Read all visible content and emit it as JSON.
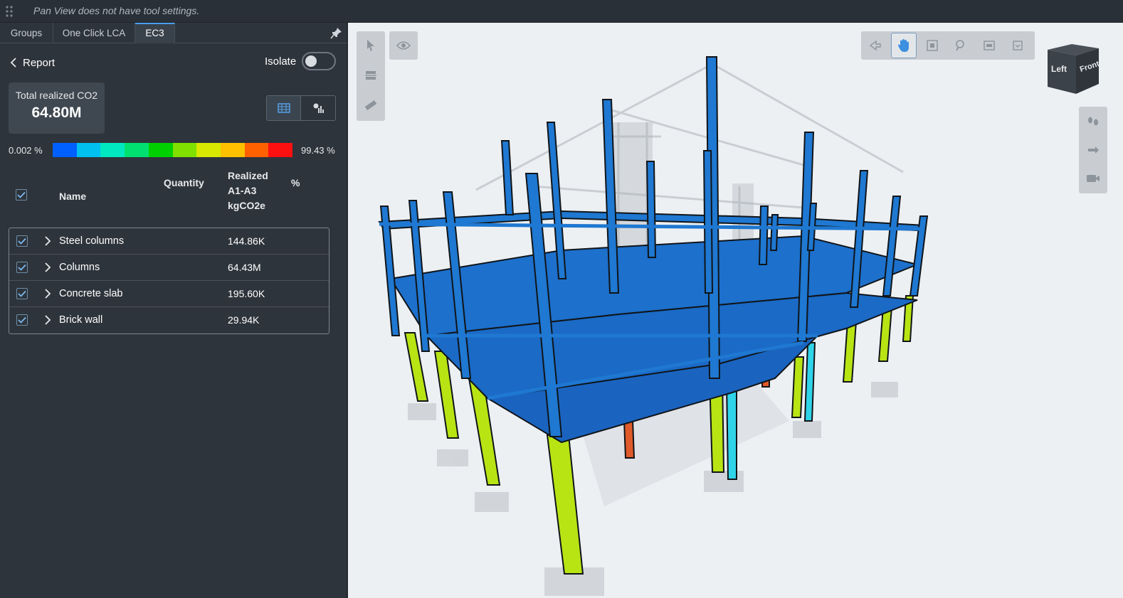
{
  "topbar": {
    "message": "Pan View does not have tool settings."
  },
  "tabs": [
    {
      "label": "Groups",
      "active": false
    },
    {
      "label": "One Click LCA",
      "active": false
    },
    {
      "label": "EC3",
      "active": true
    }
  ],
  "report": {
    "back_label": "Report",
    "isolate_label": "Isolate",
    "isolate_on": false
  },
  "total": {
    "label": "Total realized CO2",
    "value": "64.80M"
  },
  "scale": {
    "min_label": "0.002 %",
    "max_label": "99.43 %",
    "colors": [
      "#0060ff",
      "#00c0f0",
      "#00e8c0",
      "#00e070",
      "#00d000",
      "#80e000",
      "#d8e800",
      "#ffc000",
      "#ff6000",
      "#ff1010"
    ]
  },
  "table": {
    "headers": {
      "name": "Name",
      "quantity": "Quantity",
      "realized_1": "Realized",
      "realized_2": "A1-A3",
      "realized_3": "kgCO2e",
      "percent": "%"
    },
    "rows": [
      {
        "name": "Steel columns",
        "value": "144.86K",
        "checked": true
      },
      {
        "name": "Columns",
        "value": "64.43M",
        "checked": true
      },
      {
        "name": "Concrete slab",
        "value": "195.60K",
        "checked": true
      },
      {
        "name": "Brick wall",
        "value": "29.94K",
        "checked": true
      }
    ]
  },
  "viewcube": {
    "left_label": "Left",
    "front_label": "Front"
  },
  "model_colors": {
    "structure": "#1f78d1",
    "slab": "#1a64c0",
    "low": "#b8e414",
    "cyan": "#2fd4e8",
    "high": "#e05a2a"
  }
}
